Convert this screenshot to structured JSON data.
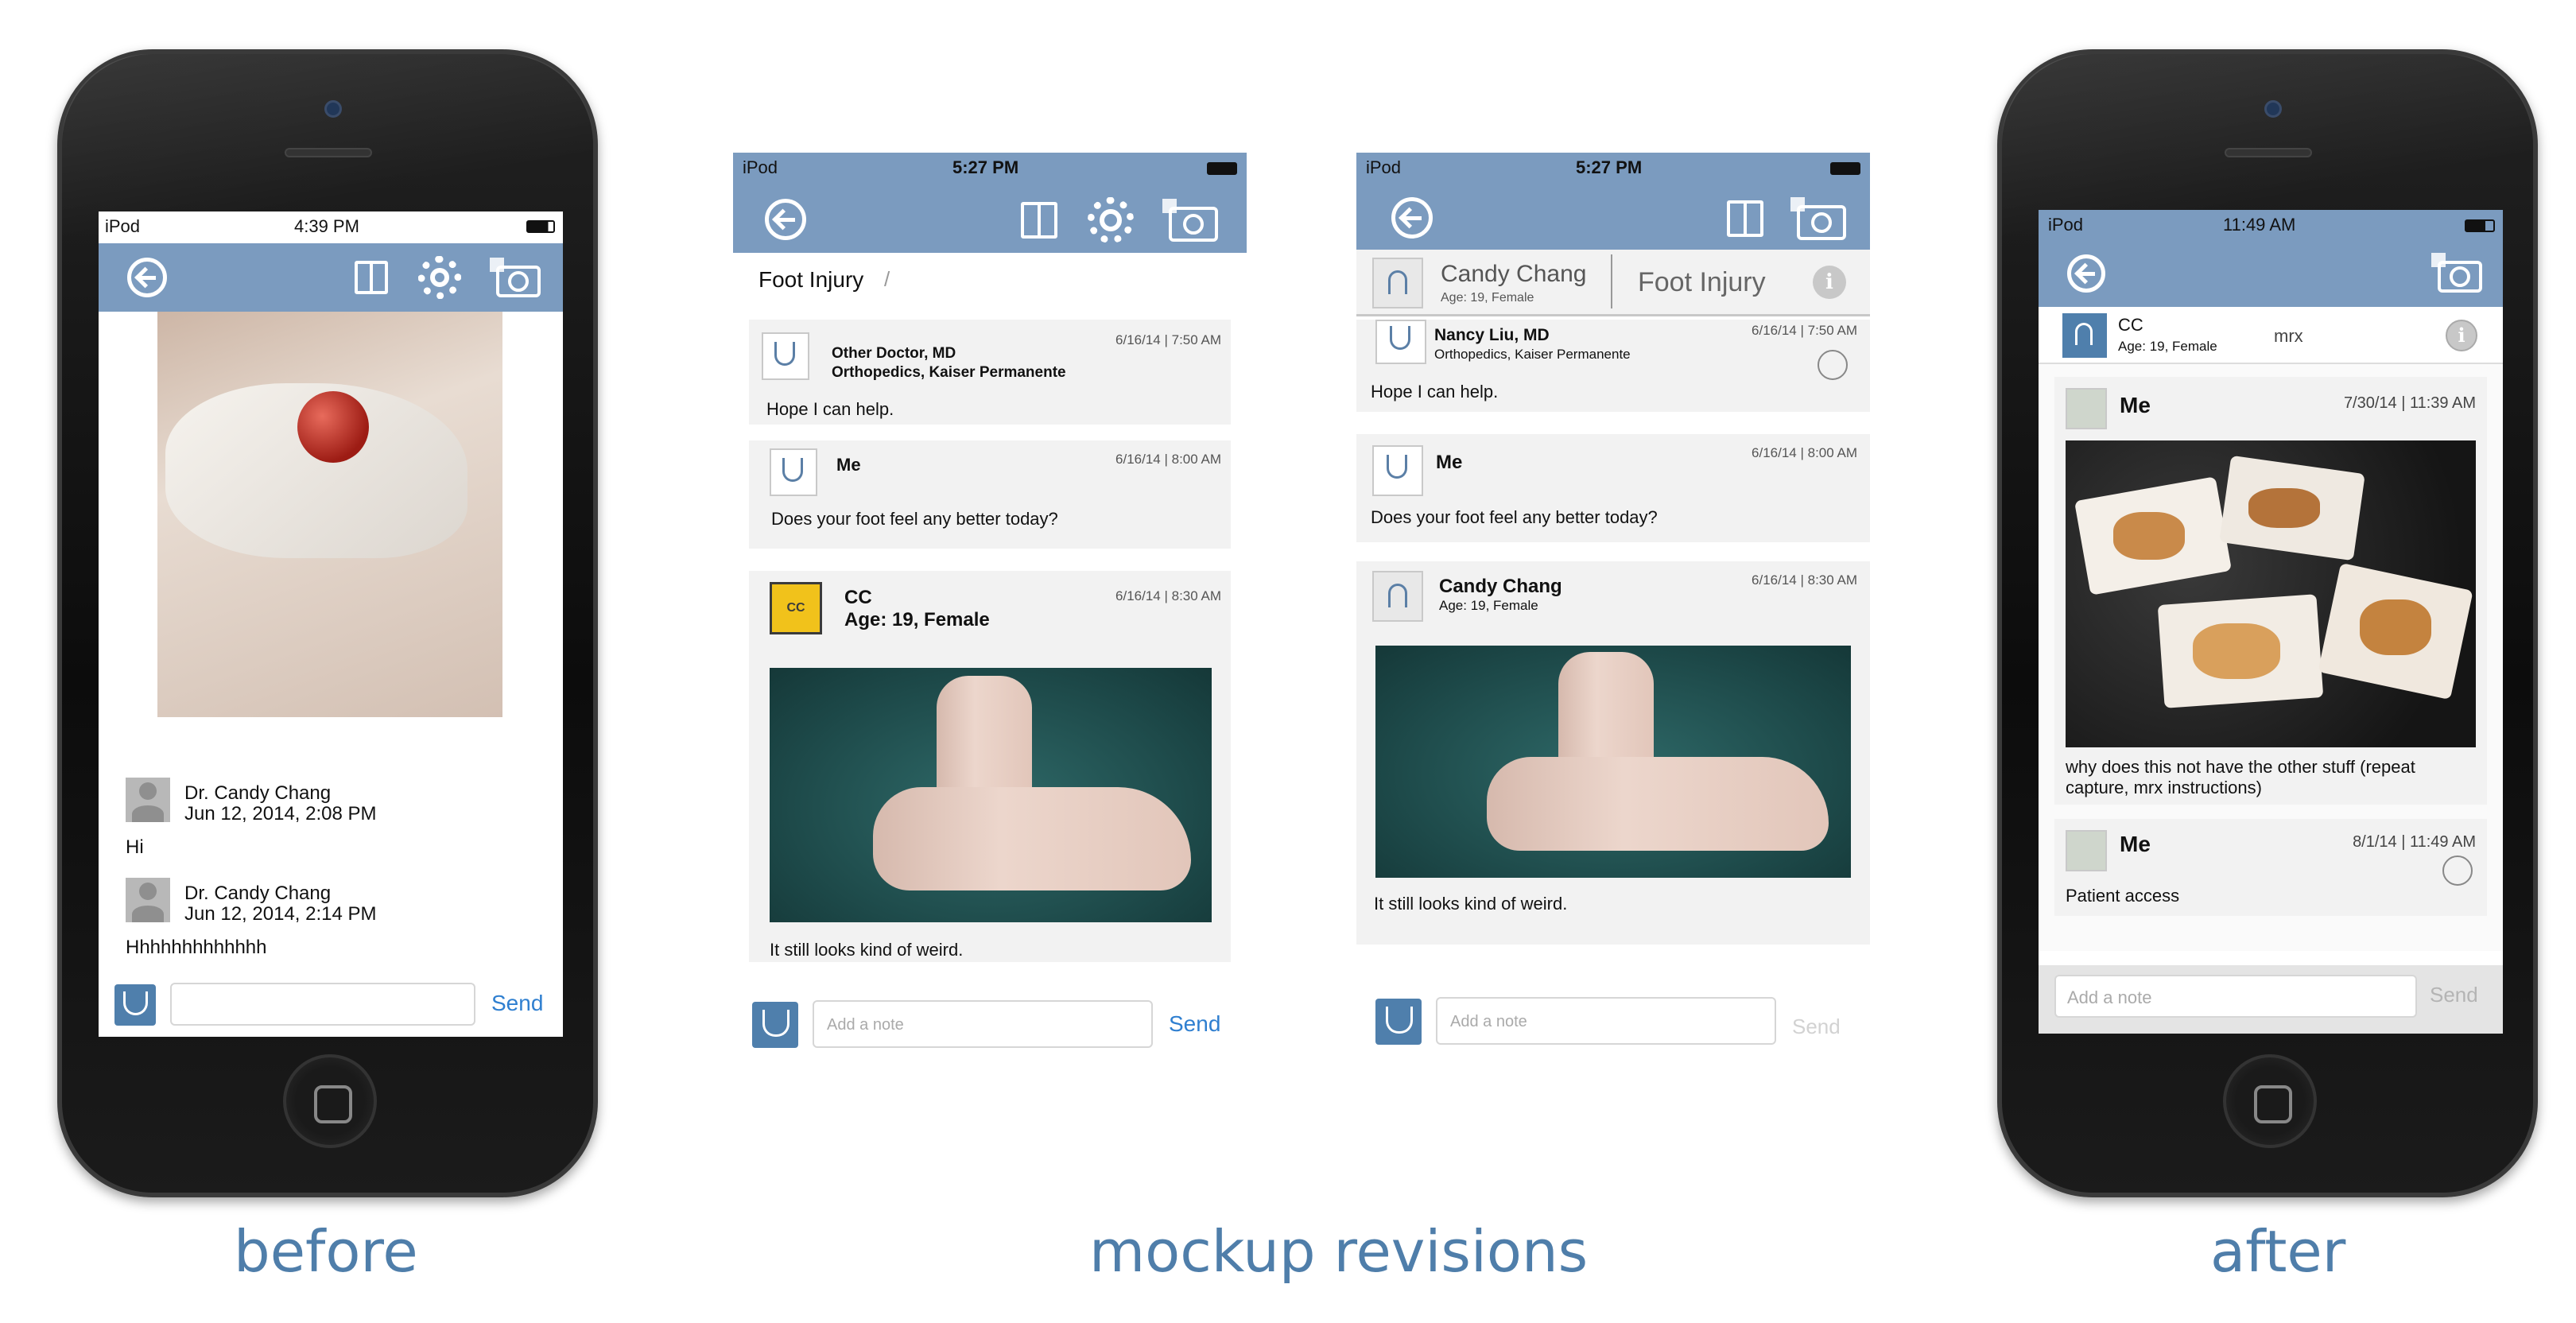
{
  "captions": {
    "before": "before",
    "mockup": "mockup revisions",
    "after": "after"
  },
  "colors": {
    "accent_blue": "#7b9bbf",
    "send_blue": "#2f7fd0",
    "caption_blue": "#4f7eaa",
    "card_bg": "#f2f2f2"
  },
  "before": {
    "status": {
      "carrier": "iPod",
      "time": "4:39 PM"
    },
    "messages": [
      {
        "name": "Dr. Candy Chang",
        "date": "Jun 12, 2014, 2:08 PM",
        "text": "Hi"
      },
      {
        "name": "Dr. Candy Chang",
        "date": "Jun 12, 2014, 2:14 PM",
        "text": "Hhhhhhhhhhhhh"
      }
    ],
    "input": {
      "placeholder": "",
      "send": "Send"
    }
  },
  "mockup1": {
    "status": {
      "carrier": "iPod",
      "time": "5:27 PM"
    },
    "breadcrumb": {
      "label": "Foot Injury",
      "sep": "/"
    },
    "messages": [
      {
        "name": "Other Doctor, MD",
        "sub": "Orthopedics, Kaiser Permanente",
        "date": "6/16/14 | 7:50 AM",
        "text": "Hope I can help."
      },
      {
        "name": "Me",
        "date": "6/16/14 | 8:00 AM",
        "text": "Does your foot feel any better today?"
      },
      {
        "name": "CC",
        "sub": "Age: 19, Female",
        "date": "6/16/14 | 8:30 AM",
        "text": "It still looks kind of weird.",
        "badge": "CC"
      }
    ],
    "input": {
      "placeholder": "Add a note",
      "send": "Send"
    }
  },
  "mockup2": {
    "status": {
      "carrier": "iPod",
      "time": "5:27 PM"
    },
    "patient": {
      "name": "Candy Chang",
      "sub": "Age: 19, Female",
      "topic": "Foot Injury"
    },
    "messages": [
      {
        "name": "Nancy Liu, MD",
        "sub": "Orthopedics, Kaiser Permanente",
        "date": "6/16/14 | 7:50 AM",
        "text": "Hope I can help."
      },
      {
        "name": "Me",
        "date": "6/16/14 | 8:00 AM",
        "text": "Does your foot feel any better today?"
      },
      {
        "name": "Candy Chang",
        "sub": "Age: 19, Female",
        "date": "6/16/14 | 8:30 AM",
        "text": "It still looks kind of weird."
      }
    ],
    "input": {
      "placeholder": "Add a note",
      "send": "Send"
    }
  },
  "after": {
    "status": {
      "carrier": "iPod",
      "time": "11:49 AM"
    },
    "patient": {
      "name": "CC",
      "sub": "Age: 19, Female",
      "topic": "mrx"
    },
    "messages": [
      {
        "name": "Me",
        "date": "7/30/14 | 11:39 AM",
        "text": "why does this not have the other stuff (repeat capture, mrx instructions)"
      },
      {
        "name": "Me",
        "date": "8/1/14 | 11:49 AM",
        "text": "Patient access"
      }
    ],
    "input": {
      "placeholder": "Add a note",
      "send": "Send"
    }
  }
}
